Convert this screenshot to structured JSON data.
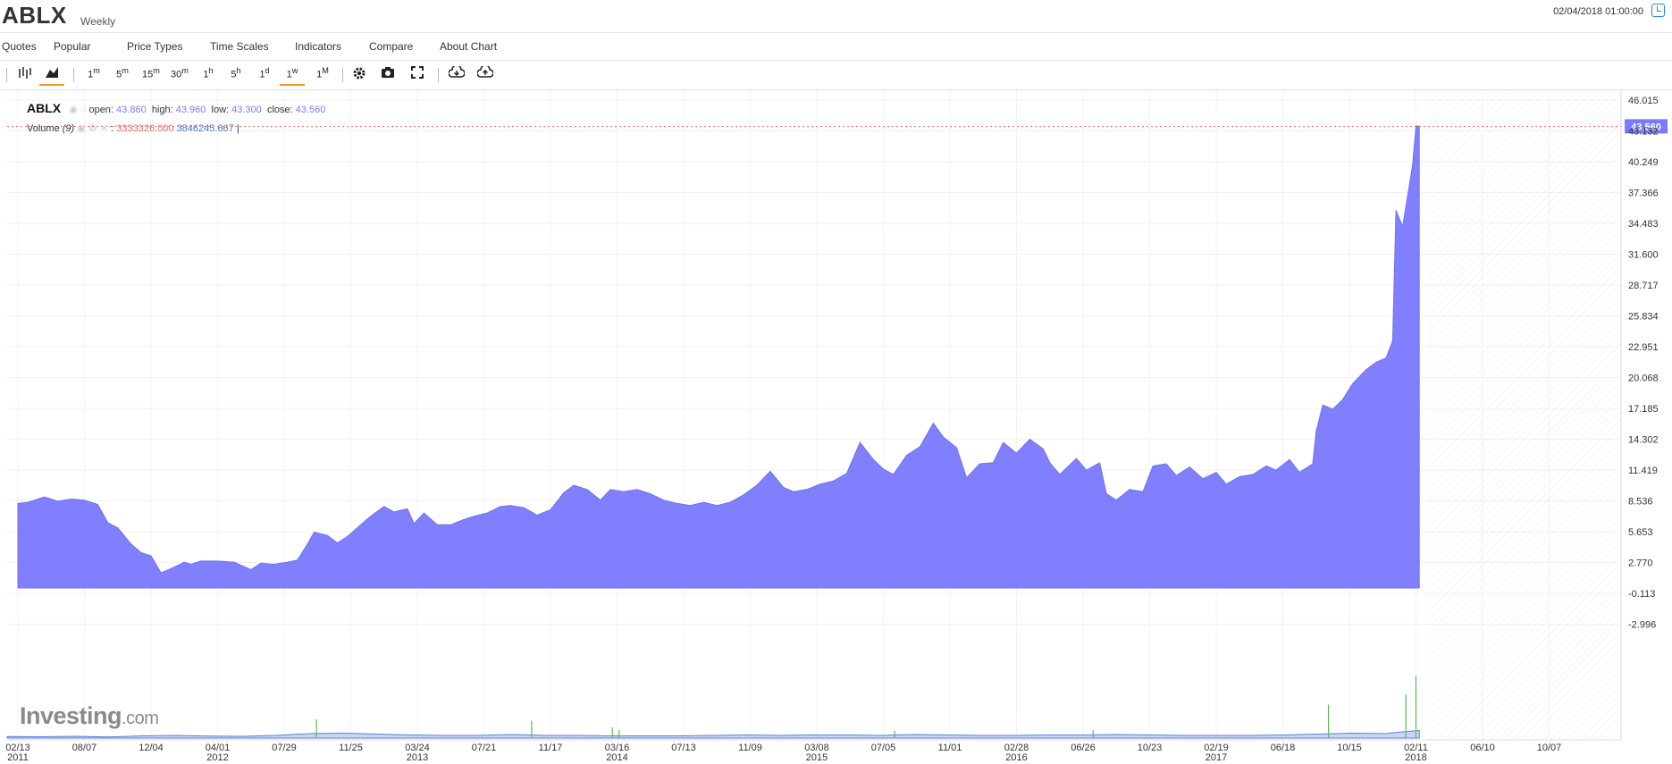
{
  "header": {
    "symbol": "ABLX",
    "period": "Weekly",
    "datetime": "02/04/2018 01:00:00",
    "clock_icon": "clock-icon"
  },
  "menu": [
    "Quotes",
    "Popular",
    "Price Types",
    "Time Scales",
    "Indicators",
    "Compare",
    "About Chart"
  ],
  "toolbar": {
    "chart_types": [
      "candlestick-icon",
      "area-icon"
    ],
    "intervals": [
      {
        "base": "1",
        "sup": "m"
      },
      {
        "base": "5",
        "sup": "m"
      },
      {
        "base": "15",
        "sup": "m"
      },
      {
        "base": "30",
        "sup": "m"
      },
      {
        "base": "1",
        "sup": "h"
      },
      {
        "base": "5",
        "sup": "h"
      },
      {
        "base": "1",
        "sup": "d"
      },
      {
        "base": "1",
        "sup": "w"
      },
      {
        "base": "1",
        "sup": "M"
      }
    ],
    "active_interval": "1w",
    "tools": [
      "gear-icon",
      "camera-icon",
      "fullscreen-icon",
      "download-icon",
      "upload-icon"
    ]
  },
  "legend": {
    "name": "ABLX",
    "open_label": "open:",
    "open": "43.860",
    "high_label": "high:",
    "high": "43.960",
    "low_label": "low:",
    "low": "43.300",
    "close_label": "close:",
    "close": "43.560"
  },
  "volume_legend": {
    "label": "Volume",
    "period": "(9)",
    "v1": "3333326.000",
    "v2": "3846245.667",
    "sep": ":",
    "end": "|"
  },
  "last_price": "43.560",
  "logo": {
    "main": "Investing",
    "suffix": ".com"
  },
  "colors": {
    "area": "#8080ff",
    "accent": "#f29b1e",
    "price_tag": "#7a7aff"
  },
  "chart_data": {
    "type": "area",
    "title": "",
    "xlabel": "",
    "ylabel": "",
    "ylim": [
      -2.996,
      46.015
    ],
    "y_ticks": [
      "46.015",
      "43.132",
      "40.249",
      "37.366",
      "34.483",
      "31.600",
      "28.717",
      "25.834",
      "22.951",
      "20.068",
      "17.185",
      "14.302",
      "11.419",
      "8.536",
      "5.653",
      "2.770",
      "-0.113",
      "-2.996"
    ],
    "x_ticks": [
      {
        "label": "02/13",
        "year": "2011"
      },
      {
        "label": "08/07",
        "year": ""
      },
      {
        "label": "12/04",
        "year": ""
      },
      {
        "label": "04/01",
        "year": "2012"
      },
      {
        "label": "07/29",
        "year": ""
      },
      {
        "label": "11/25",
        "year": ""
      },
      {
        "label": "03/24",
        "year": "2013"
      },
      {
        "label": "07/21",
        "year": ""
      },
      {
        "label": "11/17",
        "year": ""
      },
      {
        "label": "03/16",
        "year": "2014"
      },
      {
        "label": "07/13",
        "year": ""
      },
      {
        "label": "11/09",
        "year": ""
      },
      {
        "label": "03/08",
        "year": "2015"
      },
      {
        "label": "07/05",
        "year": ""
      },
      {
        "label": "11/01",
        "year": ""
      },
      {
        "label": "02/28",
        "year": "2016"
      },
      {
        "label": "06/26",
        "year": ""
      },
      {
        "label": "10/23",
        "year": ""
      },
      {
        "label": "02/19",
        "year": "2017"
      },
      {
        "label": "06/18",
        "year": ""
      },
      {
        "label": "10/15",
        "year": ""
      },
      {
        "label": "02/11",
        "year": "2018"
      },
      {
        "label": "06/10",
        "year": ""
      },
      {
        "label": "10/07",
        "year": ""
      }
    ],
    "series": [
      {
        "values": [
          [
            0,
            8.3
          ],
          [
            0.3,
            8.4
          ],
          [
            0.8,
            8.9
          ],
          [
            1.2,
            8.5
          ],
          [
            1.6,
            8.7
          ],
          [
            2.0,
            8.6
          ],
          [
            2.4,
            8.2
          ],
          [
            2.7,
            6.5
          ],
          [
            3.0,
            6.0
          ],
          [
            3.4,
            4.5
          ],
          [
            3.7,
            3.7
          ],
          [
            4.0,
            3.4
          ],
          [
            4.3,
            1.8
          ],
          [
            4.6,
            2.2
          ],
          [
            5.0,
            2.8
          ],
          [
            5.2,
            2.6
          ],
          [
            5.5,
            2.9
          ],
          [
            6.0,
            2.9
          ],
          [
            6.5,
            2.8
          ],
          [
            7.0,
            2.1
          ],
          [
            7.3,
            2.7
          ],
          [
            7.7,
            2.6
          ],
          [
            8.1,
            2.8
          ],
          [
            8.4,
            3.0
          ],
          [
            8.7,
            4.5
          ],
          [
            8.9,
            5.6
          ],
          [
            9.3,
            5.3
          ],
          [
            9.6,
            4.6
          ],
          [
            9.9,
            5.2
          ],
          [
            10.3,
            6.3
          ],
          [
            10.6,
            7.1
          ],
          [
            11.0,
            8.0
          ],
          [
            11.3,
            7.5
          ],
          [
            11.7,
            7.8
          ],
          [
            11.9,
            6.4
          ],
          [
            12.2,
            7.4
          ],
          [
            12.6,
            6.3
          ],
          [
            13.0,
            6.3
          ],
          [
            13.4,
            6.8
          ],
          [
            13.7,
            7.1
          ],
          [
            14.1,
            7.4
          ],
          [
            14.5,
            8.0
          ],
          [
            14.8,
            8.1
          ],
          [
            15.2,
            7.9
          ],
          [
            15.6,
            7.2
          ],
          [
            16.0,
            7.7
          ],
          [
            16.4,
            9.3
          ],
          [
            16.7,
            10.0
          ],
          [
            17.1,
            9.6
          ],
          [
            17.5,
            8.6
          ],
          [
            17.8,
            9.6
          ],
          [
            18.2,
            9.4
          ],
          [
            18.6,
            9.6
          ],
          [
            19.0,
            9.2
          ],
          [
            19.4,
            8.6
          ],
          [
            19.8,
            8.3
          ],
          [
            20.2,
            8.1
          ],
          [
            20.6,
            8.4
          ],
          [
            21.0,
            8.1
          ],
          [
            21.4,
            8.4
          ],
          [
            21.8,
            9.1
          ],
          [
            22.2,
            10.0
          ],
          [
            22.6,
            11.3
          ],
          [
            23.0,
            9.8
          ],
          [
            23.3,
            9.4
          ],
          [
            23.7,
            9.6
          ],
          [
            24.1,
            10.1
          ],
          [
            24.5,
            10.4
          ],
          [
            24.9,
            11.1
          ],
          [
            25.3,
            14.0
          ],
          [
            25.7,
            12.4
          ],
          [
            26.0,
            11.5
          ],
          [
            26.3,
            11.0
          ],
          [
            26.7,
            12.8
          ],
          [
            27.1,
            13.6
          ],
          [
            27.5,
            15.8
          ],
          [
            27.8,
            14.5
          ],
          [
            28.2,
            13.5
          ],
          [
            28.5,
            10.7
          ],
          [
            28.9,
            12.0
          ],
          [
            29.3,
            12.1
          ],
          [
            29.6,
            14.0
          ],
          [
            30.0,
            13.0
          ],
          [
            30.4,
            14.3
          ],
          [
            30.8,
            13.4
          ],
          [
            31.0,
            12.1
          ],
          [
            31.3,
            11.0
          ],
          [
            31.8,
            12.5
          ],
          [
            32.1,
            11.4
          ],
          [
            32.5,
            12.1
          ],
          [
            32.7,
            9.2
          ],
          [
            33.0,
            8.6
          ],
          [
            33.4,
            9.6
          ],
          [
            33.8,
            9.4
          ],
          [
            34.1,
            11.8
          ],
          [
            34.5,
            12.0
          ],
          [
            34.8,
            10.9
          ],
          [
            35.2,
            11.7
          ],
          [
            35.6,
            10.6
          ],
          [
            36.0,
            11.2
          ],
          [
            36.3,
            10.1
          ],
          [
            36.7,
            10.8
          ],
          [
            37.1,
            11.0
          ],
          [
            37.5,
            11.8
          ],
          [
            37.8,
            11.4
          ],
          [
            38.2,
            12.4
          ],
          [
            38.5,
            11.2
          ],
          [
            38.9,
            12.0
          ],
          [
            39.0,
            15.0
          ],
          [
            39.2,
            17.5
          ],
          [
            39.5,
            17.1
          ],
          [
            39.8,
            18.0
          ],
          [
            40.1,
            19.5
          ],
          [
            40.5,
            20.8
          ],
          [
            40.8,
            21.5
          ],
          [
            41.1,
            21.9
          ],
          [
            41.3,
            23.5
          ],
          [
            41.4,
            35.7
          ],
          [
            41.6,
            34.2
          ],
          [
            41.8,
            38.0
          ],
          [
            41.9,
            40.0
          ],
          [
            42.0,
            43.6
          ],
          [
            42.1,
            43.56
          ]
        ],
        "volume": [
          [
            0,
            0.18
          ],
          [
            1,
            0.15
          ],
          [
            2,
            0.2
          ],
          [
            3,
            0.12
          ],
          [
            4,
            0.25
          ],
          [
            5,
            0.3
          ],
          [
            6,
            0.22
          ],
          [
            7,
            0.2
          ],
          [
            8,
            0.3
          ],
          [
            9,
            0.5
          ],
          [
            10,
            0.55
          ],
          [
            11,
            0.45
          ],
          [
            12,
            0.35
          ],
          [
            13,
            0.3
          ],
          [
            14,
            0.3
          ],
          [
            15,
            0.4
          ],
          [
            16,
            0.3
          ],
          [
            17,
            0.3
          ],
          [
            18,
            0.25
          ],
          [
            19,
            0.25
          ],
          [
            20,
            0.25
          ],
          [
            21,
            0.3
          ],
          [
            22,
            0.35
          ],
          [
            23,
            0.3
          ],
          [
            24,
            0.35
          ],
          [
            25,
            0.35
          ],
          [
            26,
            0.3
          ],
          [
            27,
            0.4
          ],
          [
            28,
            0.35
          ],
          [
            29,
            0.3
          ],
          [
            30,
            0.3
          ],
          [
            31,
            0.35
          ],
          [
            32,
            0.35
          ],
          [
            33,
            0.4
          ],
          [
            34,
            0.35
          ],
          [
            35,
            0.3
          ],
          [
            36,
            0.3
          ],
          [
            37,
            0.3
          ],
          [
            38,
            0.35
          ],
          [
            39,
            0.45
          ],
          [
            40,
            0.55
          ],
          [
            41,
            0.5
          ],
          [
            41.5,
            0.7
          ],
          [
            42,
            0.85
          ]
        ],
        "volume_spikes": [
          [
            9.2,
            2.8
          ],
          [
            15.6,
            2.6
          ],
          [
            18.0,
            1.6
          ],
          [
            18.2,
            1.2
          ],
          [
            26.4,
            1.1
          ],
          [
            32.3,
            1.2
          ],
          [
            39.3,
            5.0
          ],
          [
            41.6,
            6.5
          ],
          [
            41.9,
            9.3
          ]
        ]
      }
    ]
  }
}
